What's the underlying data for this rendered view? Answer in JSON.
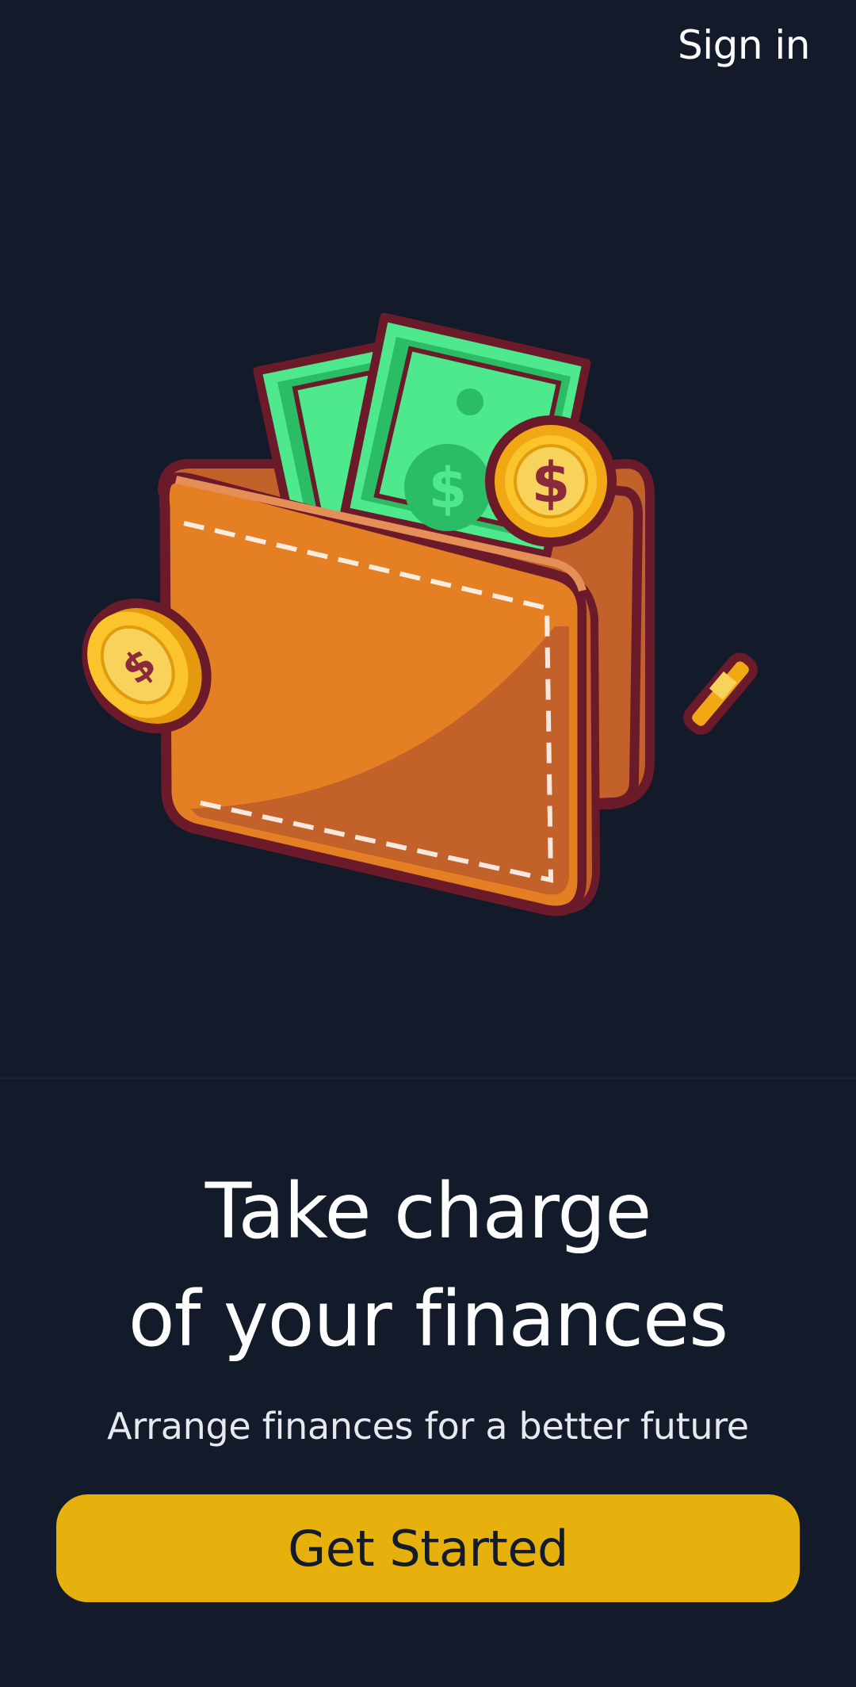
{
  "header": {
    "sign_in_label": "Sign in"
  },
  "hero": {
    "illustration": "wallet-with-cash-and-coins-illustration"
  },
  "main": {
    "headline_line1": "Take charge",
    "headline_line2": "of your finances",
    "subtitle": "Arrange finances for a better future",
    "cta_label": "Get Started"
  },
  "colors": {
    "background": "#131a29",
    "accent": "#e6b10c",
    "text": "#ffffff",
    "cta_text": "#131a29"
  }
}
